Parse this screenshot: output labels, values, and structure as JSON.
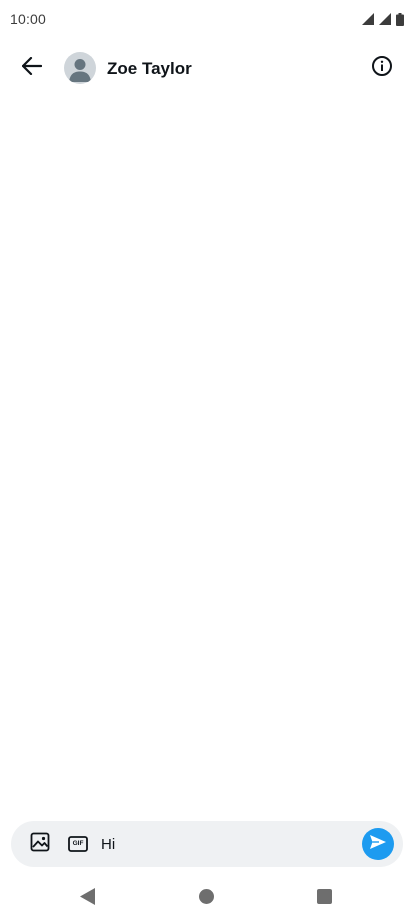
{
  "status_bar": {
    "time": "10:00",
    "icons": [
      "wifi-icon",
      "signal-icon",
      "battery-icon"
    ]
  },
  "header": {
    "back_icon": "arrow-left-icon",
    "avatar_icon": "default-avatar-icon",
    "contact_name": "Zoe Taylor",
    "info_icon": "info-circle-icon"
  },
  "composer": {
    "media_icon": "image-icon",
    "gif_icon": "gif-icon",
    "gif_glyph": "GIF",
    "message_value": "Hi",
    "send_icon": "send-icon",
    "send_color": "#1d9bf0",
    "background": "#eff1f3"
  },
  "nav_bar": {
    "icons": [
      "nav-back-icon",
      "nav-home-icon",
      "nav-recents-icon"
    ]
  }
}
